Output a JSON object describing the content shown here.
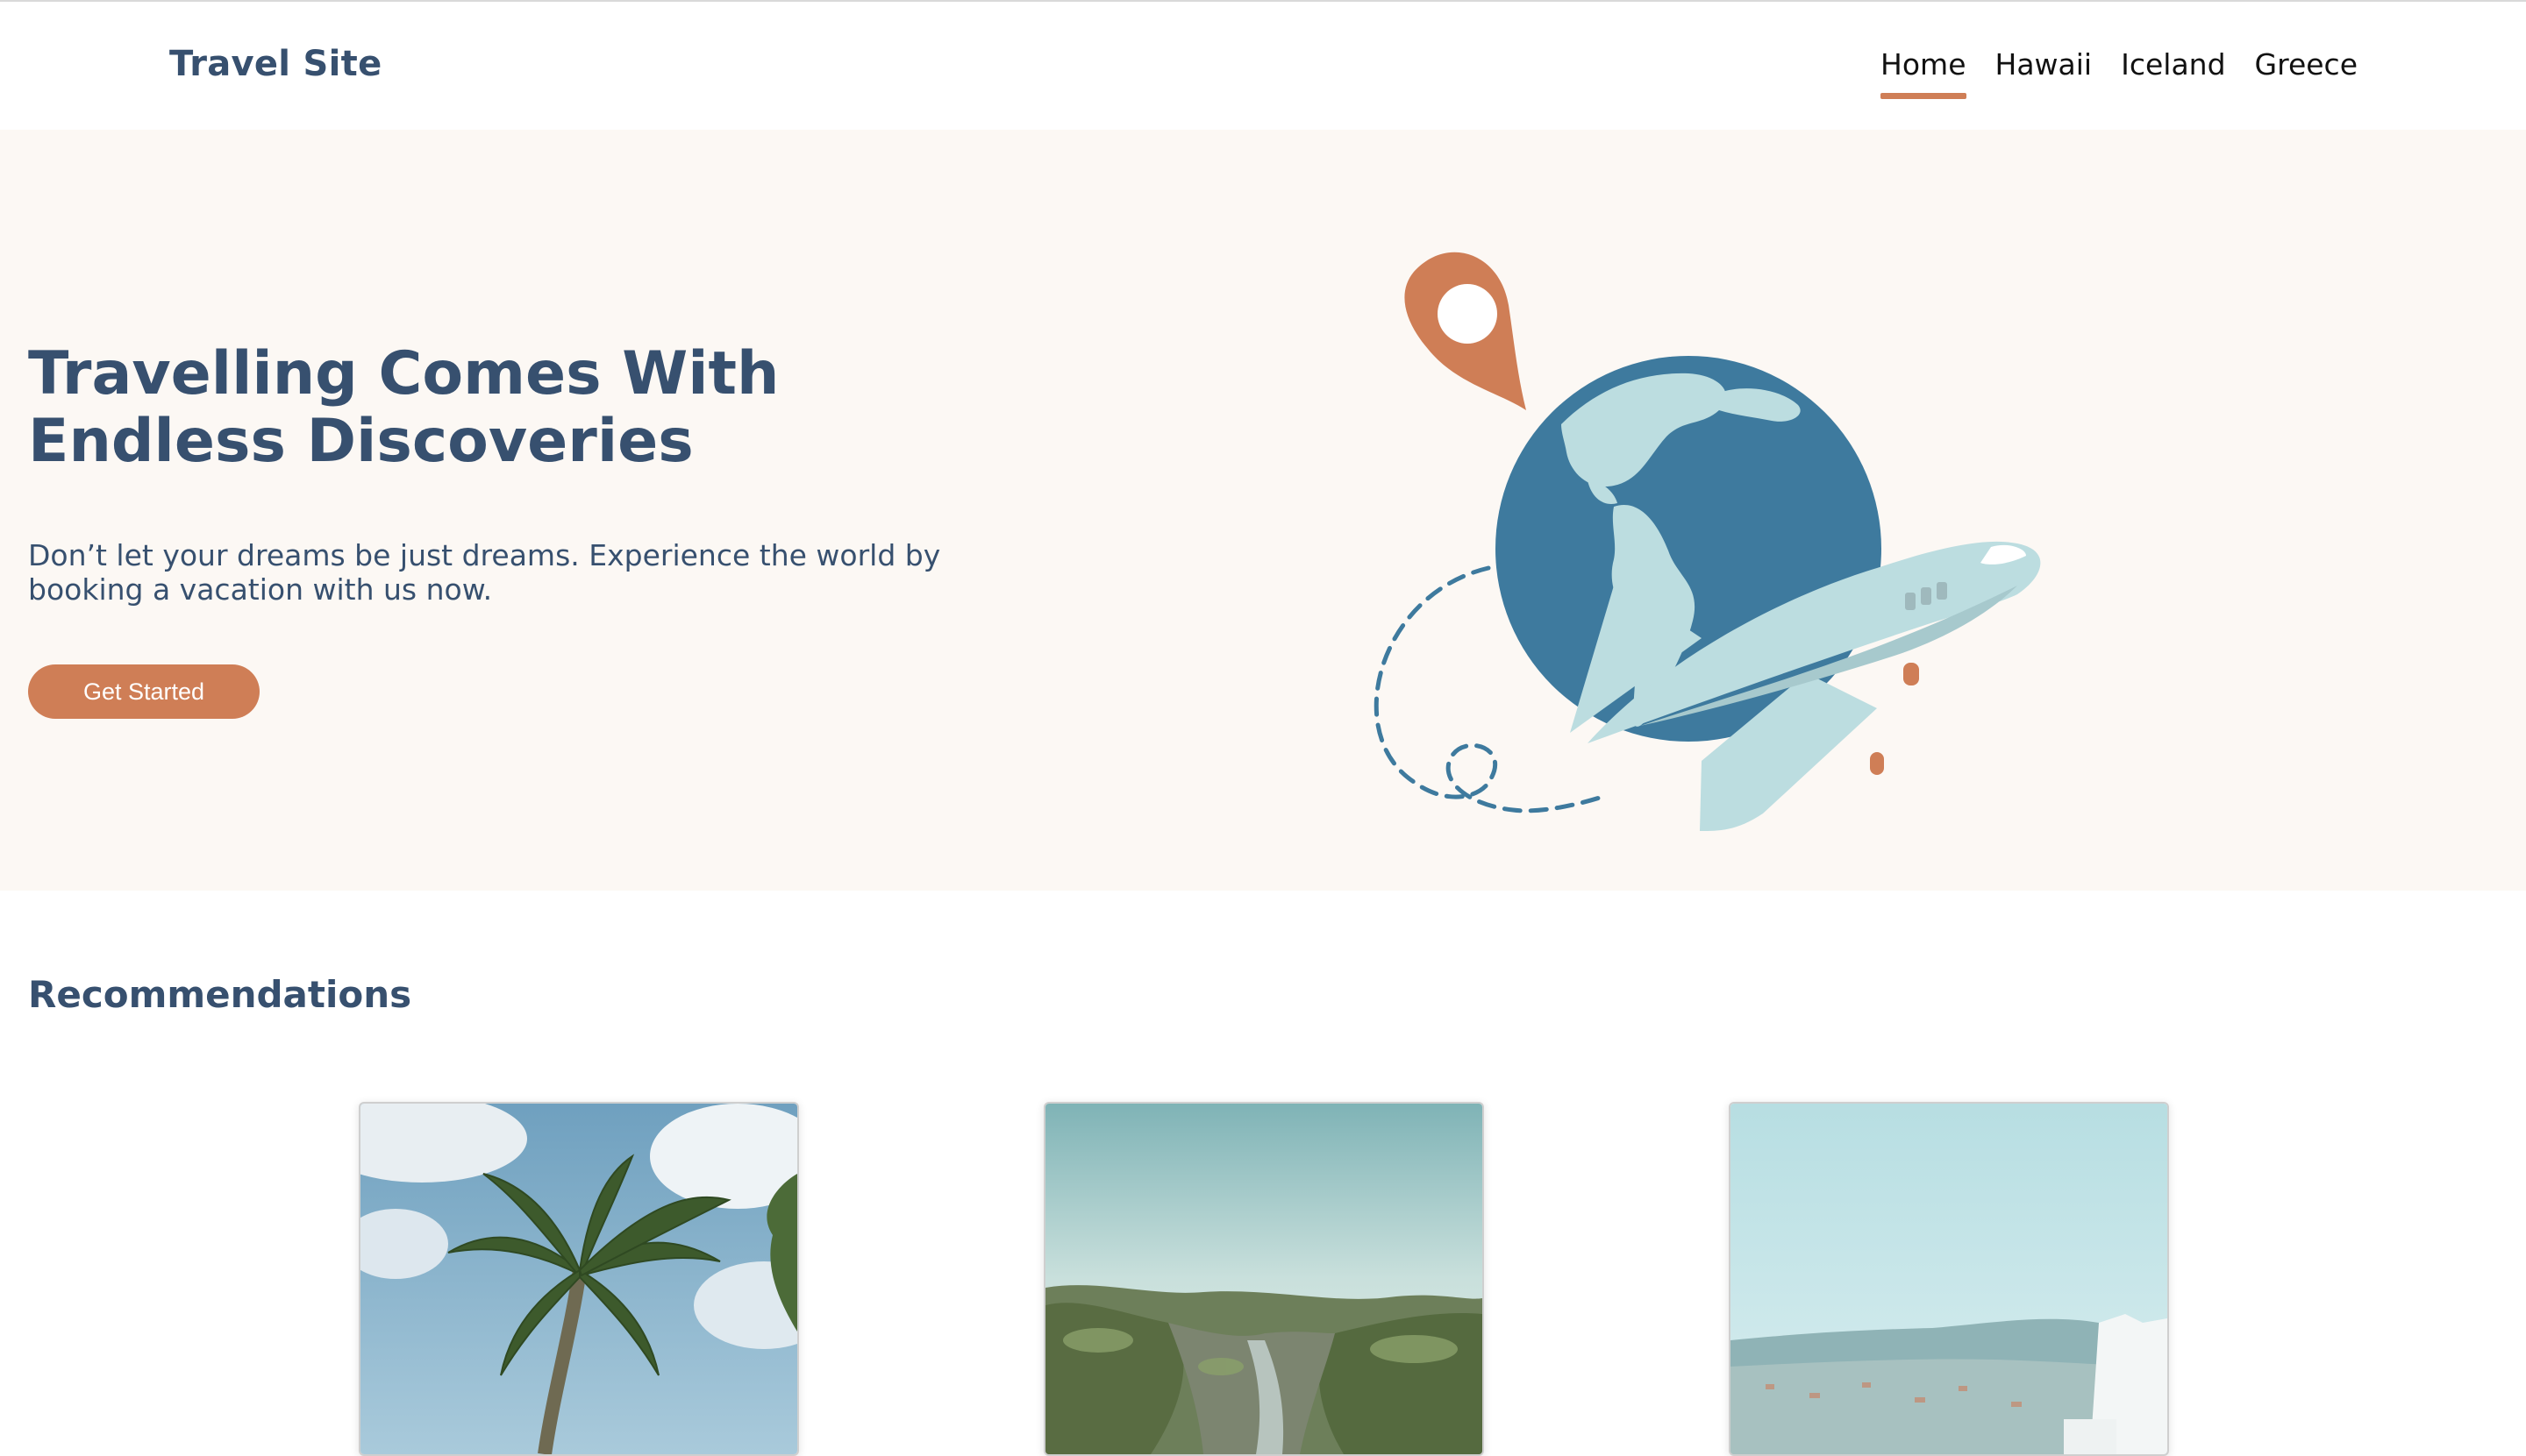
{
  "header": {
    "logo": "Travel Site",
    "nav": [
      "Home",
      "Hawaii",
      "Iceland",
      "Greece"
    ]
  },
  "hero": {
    "title": "Travelling Comes With Endless Discoveries",
    "subtitle": "Don’t let your dreams be just dreams. Experience the world by booking a vacation with us now.",
    "cta": "Get Started"
  },
  "recommendations": {
    "title": "Recommendations"
  },
  "colors": {
    "brand_text": "#37506f",
    "accent": "#cf7e56",
    "hero_bg": "#fcf8f4",
    "globe_blue": "#3e7a9e",
    "globe_land": "#bcdde0"
  }
}
